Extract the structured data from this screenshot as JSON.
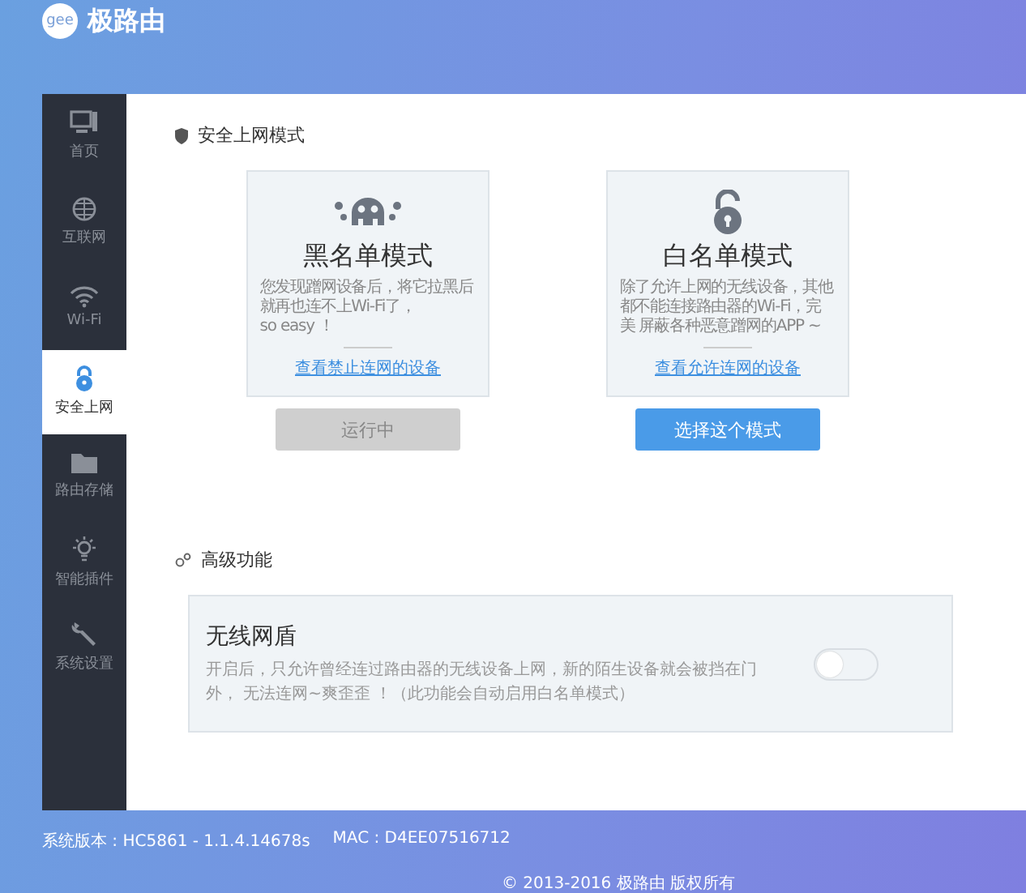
{
  "header": {
    "logo_text": "gee",
    "title": "极路由"
  },
  "sidebar": {
    "items": [
      {
        "kind": "monitor",
        "label": "首页",
        "selected": false
      },
      {
        "kind": "globe",
        "label": "互联网",
        "selected": false
      },
      {
        "kind": "wifi",
        "label": "Wi-Fi",
        "selected": false
      },
      {
        "kind": "lock",
        "label": "安全上网",
        "selected": true
      },
      {
        "kind": "folder",
        "label": "路由存储",
        "selected": false
      },
      {
        "kind": "bulb",
        "label": "智能插件",
        "selected": false
      },
      {
        "kind": "wrench",
        "label": "系统设置",
        "selected": false
      }
    ]
  },
  "security": {
    "title": "安全上网模式",
    "modes": [
      {
        "kind": "blacklist",
        "title": "黑名单模式",
        "description": "您发现蹭网设备后，将它拉黑后就再也连不上Wi-Fi了，\nso easy ！",
        "link": "查看禁止连网的设备",
        "button": "运行中",
        "active": true
      },
      {
        "kind": "whitelist",
        "title": "白名单模式",
        "description": "除了允许上网的无线设备，其他都不能连接路由器的Wi-Fi，完美 屏蔽各种恶意蹭网的APP ~",
        "link": "查看允许连网的设备",
        "button": "选择这个模式",
        "active": false
      }
    ]
  },
  "advanced": {
    "title": "高级功能",
    "features": [
      {
        "title": "无线网盾",
        "description": "开启后，只允许曾经连过路由器的无线设备上网，新的陌生设备就会被挡在门外， 无法连网~爽歪歪 ！（此功能会自动启用白名单模式）",
        "on": false
      }
    ]
  },
  "footer": {
    "version": "系统版本 : HC5861 - 1.1.4.14678s",
    "mac": "MAC : D4EE07516712",
    "copyright": "© 2013-2016 极路由 版权所有"
  }
}
